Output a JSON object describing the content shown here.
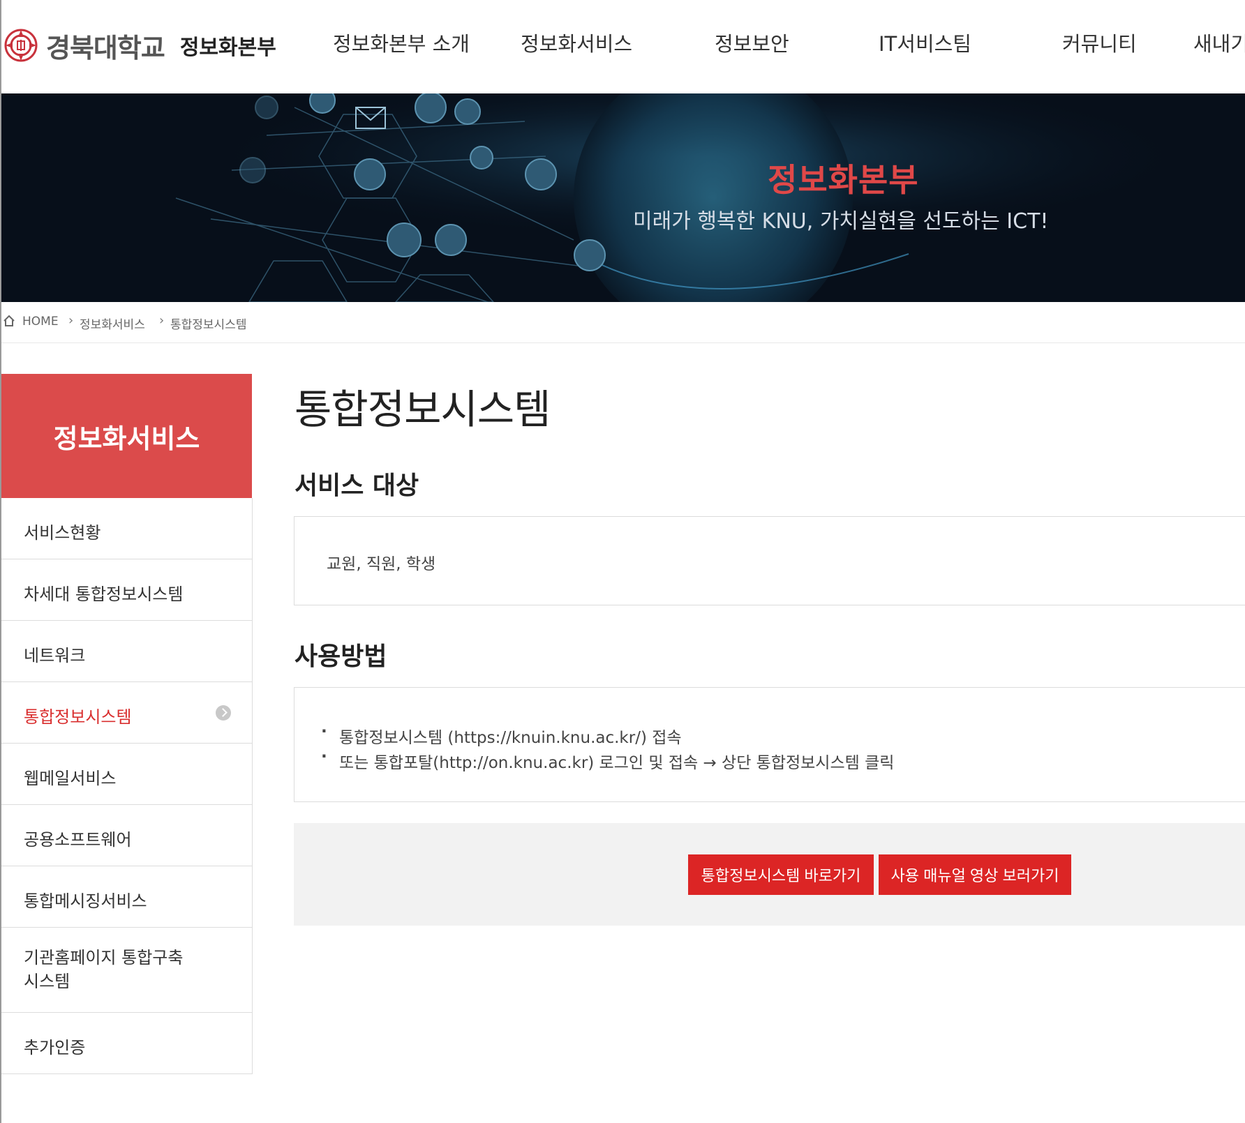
{
  "header": {
    "logo_text": "경북대학교",
    "logo_sub": "정보화본부",
    "nav": [
      "정보화본부 소개",
      "정보화서비스",
      "정보보안",
      "IT서비스팀",
      "커뮤니티",
      "새내기"
    ]
  },
  "banner": {
    "title": "정보화본부",
    "subtitle": "미래가 행복한 KNU, 가치실현을 선도하는 ICT!"
  },
  "breadcrumb": [
    "HOME",
    "정보화서비스",
    "통합정보시스템"
  ],
  "sidebar": {
    "title": "정보화서비스",
    "items": [
      {
        "label": "서비스현황"
      },
      {
        "label": "차세대 통합정보시스템"
      },
      {
        "label": "네트워크"
      },
      {
        "label": "통합정보시스템",
        "active": true
      },
      {
        "label": "웹메일서비스"
      },
      {
        "label": "공용소프트웨어"
      },
      {
        "label": "통합메시징서비스"
      },
      {
        "label": "기관홈페이지 통합구축\n시스템"
      },
      {
        "label": "추가인증"
      }
    ]
  },
  "main": {
    "title": "통합정보시스템",
    "service_target": {
      "heading": "서비스 대상",
      "text": "교원, 직원, 학생"
    },
    "usage": {
      "heading": "사용방법",
      "items": [
        "통합정보시스템 (https://knuin.knu.ac.kr/) 접속",
        "또는 통합포탈(http://on.knu.ac.kr) 로그인 및 접속 → 상단 통합정보시스템 클릭"
      ]
    },
    "buttons": {
      "shortcut": "통합정보시스템 바로가기",
      "manual": "사용 매뉴얼 영상 보러가기"
    }
  },
  "colors": {
    "accent": "#db4b4b",
    "button": "#dc2525",
    "active_text": "#d92f2f",
    "banner_bg": "#070f1a"
  },
  "icons": [
    "emblem-icon",
    "home-icon",
    "chevron-right-icon",
    "arrow-circle-icon"
  ]
}
